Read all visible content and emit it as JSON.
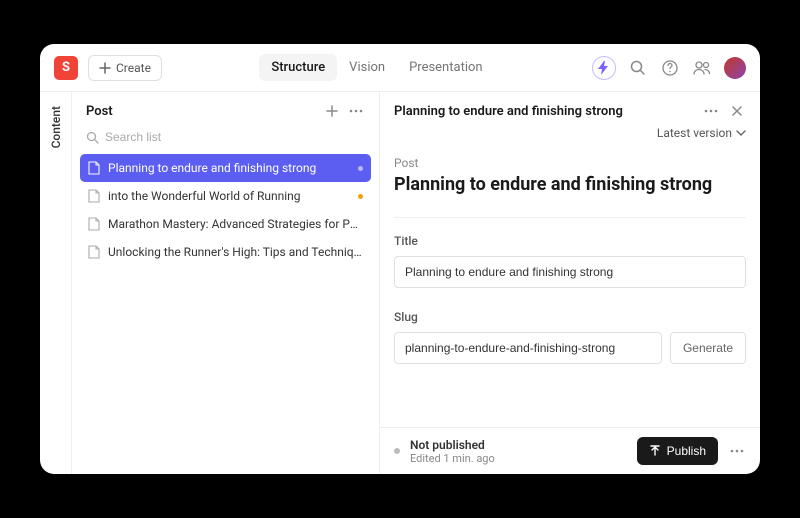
{
  "topbar": {
    "logo_letter": "S",
    "create_label": "Create",
    "tabs": [
      {
        "label": "Structure",
        "active": true
      },
      {
        "label": "Vision",
        "active": false
      },
      {
        "label": "Presentation",
        "active": false
      }
    ]
  },
  "rail": {
    "label": "Content"
  },
  "list_panel": {
    "title": "Post",
    "search_placeholder": "Search list",
    "items": [
      {
        "label": "Planning to endure and finishing strong",
        "active": true,
        "dot": "purple"
      },
      {
        "label": "into the Wonderful World of Running",
        "active": false,
        "dot": "orange"
      },
      {
        "label": "Marathon Mastery: Advanced Strategies for Peak P...",
        "active": false,
        "dot": null
      },
      {
        "label": "Unlocking the Runner's High: Tips and Techniques f...",
        "active": false,
        "dot": null
      }
    ]
  },
  "detail": {
    "header_title": "Planning to endure and finishing strong",
    "version_label": "Latest version",
    "kicker": "Post",
    "heading": "Planning to endure and finishing strong",
    "title_label": "Title",
    "title_value": "Planning to endure and finishing strong",
    "slug_label": "Slug",
    "slug_value": "planning-to-endure-and-finishing-strong",
    "generate_label": "Generate"
  },
  "footer": {
    "status_title": "Not published",
    "status_sub": "Edited 1 min. ago",
    "publish_label": "Publish"
  }
}
